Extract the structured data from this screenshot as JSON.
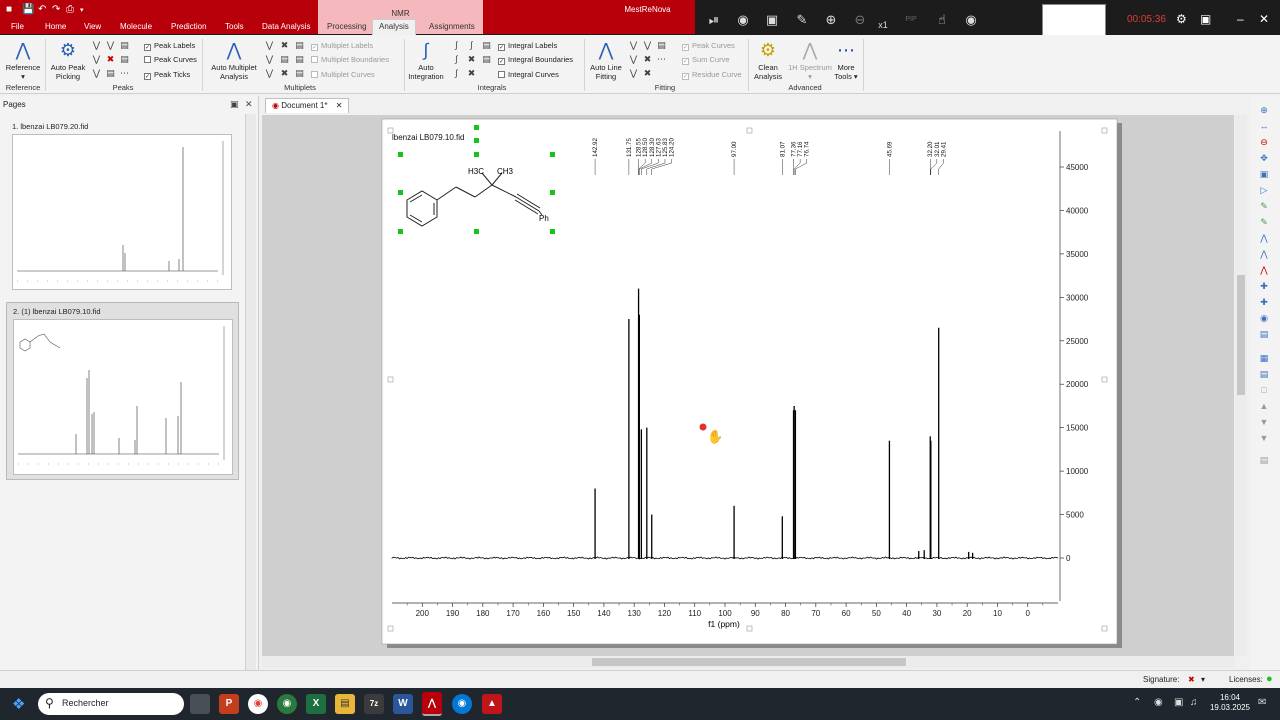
{
  "app": {
    "title": "MestReNova",
    "context_group": "NMR",
    "menu_tabs": [
      "File",
      "Home",
      "View",
      "Molecule",
      "Prediction",
      "Tools",
      "Data Analysis"
    ],
    "context_tabs": [
      "Processing",
      "Analysis",
      "Assignments"
    ],
    "active_tab": "Analysis",
    "timer": "00:05:36",
    "zoom_label": "x1",
    "overlay_tools": [
      "pause-icon",
      "stop-icon",
      "camera-icon",
      "pen-icon",
      "zoom-in-icon",
      "zoom-out-icon",
      "pip-icon",
      "touch-icon",
      "eye-icon"
    ],
    "pip_label": "PIP"
  },
  "ribbon": {
    "reference": {
      "label": "Reference",
      "group": "Reference"
    },
    "peaks": {
      "auto_peak_picking": "Auto Peak Picking",
      "checks": [
        {
          "label": "Peak Labels",
          "checked": true
        },
        {
          "label": "Peak Curves",
          "checked": false
        },
        {
          "label": "Peak Ticks",
          "checked": true
        }
      ],
      "group": "Peaks"
    },
    "multiplets": {
      "auto_multiplet": "Auto Multiplet Analysis",
      "checks": [
        {
          "label": "Multiplet Labels",
          "checked": true
        },
        {
          "label": "Multiplet Boundaries",
          "checked": false
        },
        {
          "label": "Multiplet Curves",
          "checked": false
        }
      ],
      "group": "Multiplets"
    },
    "integrals": {
      "auto_integration": "Auto Integration",
      "checks": [
        {
          "label": "Integral Labels",
          "checked": true
        },
        {
          "label": "Integral Boundaries",
          "checked": true
        },
        {
          "label": "Integral Curves",
          "checked": false
        }
      ],
      "group": "Integrals"
    },
    "fitting": {
      "auto_line_fitting": "Auto Line Fitting",
      "checks": [
        {
          "label": "Peak Curves",
          "checked": true
        },
        {
          "label": "Sum Curve",
          "checked": true
        },
        {
          "label": "Residue Curve",
          "checked": true
        }
      ],
      "group": "Fitting"
    },
    "advanced": {
      "clean_analysis": "Clean Analysis",
      "spectrum_1h": "1H Spectrum",
      "more_tools": "More Tools",
      "group": "Advanced"
    }
  },
  "pages_pane": {
    "title": "Pages",
    "items": [
      {
        "label": "1. lbenzai LB079.20.fid"
      },
      {
        "label": "2. (1) lbenzai LB079.10.fid"
      }
    ]
  },
  "document": {
    "tab_label": "Document 1*",
    "spectrum_title": "lbenzai LB079.10.fid",
    "molecule": {
      "label_h3c": "H3C",
      "label_ch3": "CH3",
      "label_ph": "Ph"
    }
  },
  "chart_data": {
    "type": "line",
    "title": "lbenzai LB079.10.fid",
    "xlabel": "f1 (ppm)",
    "ylabel": "",
    "xlim": [
      210,
      -10
    ],
    "ylim": [
      -2000,
      47000
    ],
    "x_reversed": true,
    "x_ticks": [
      200,
      190,
      180,
      170,
      160,
      150,
      140,
      130,
      120,
      110,
      100,
      90,
      80,
      70,
      60,
      50,
      40,
      30,
      20,
      10,
      0
    ],
    "y_ticks": [
      0,
      5000,
      10000,
      15000,
      20000,
      25000,
      30000,
      35000,
      40000,
      45000
    ],
    "peak_labels": [
      "142.92",
      "131.75",
      "128.55",
      "128.50",
      "128.30",
      "127.63",
      "125.83",
      "124.20",
      "97.00",
      "81.07",
      "77.36",
      "77.16",
      "76.74",
      "45.69",
      "32.20",
      "32.01",
      "29.41"
    ],
    "peaks": [
      {
        "ppm": 142.92,
        "height": 8000
      },
      {
        "ppm": 131.75,
        "height": 27500
      },
      {
        "ppm": 128.55,
        "height": 31000
      },
      {
        "ppm": 128.3,
        "height": 28000
      },
      {
        "ppm": 127.63,
        "height": 14800
      },
      {
        "ppm": 125.83,
        "height": 15000
      },
      {
        "ppm": 124.2,
        "height": 5000
      },
      {
        "ppm": 97.0,
        "height": 6000
      },
      {
        "ppm": 81.07,
        "height": 4800
      },
      {
        "ppm": 77.36,
        "height": 17000
      },
      {
        "ppm": 77.16,
        "height": 17500
      },
      {
        "ppm": 76.74,
        "height": 17000
      },
      {
        "ppm": 45.69,
        "height": 13500
      },
      {
        "ppm": 32.2,
        "height": 14000
      },
      {
        "ppm": 32.01,
        "height": 13500
      },
      {
        "ppm": 29.41,
        "height": 26500
      },
      {
        "ppm": 36.0,
        "height": 800
      },
      {
        "ppm": 34.2,
        "height": 900
      },
      {
        "ppm": 19.5,
        "height": 700
      },
      {
        "ppm": 18.2,
        "height": 600
      }
    ],
    "grid": false,
    "legend": "none"
  },
  "statusbar": {
    "signature": "Signature:",
    "licenses": "Licenses:"
  },
  "taskbar": {
    "search_placeholder": "Rechercher",
    "apps": [
      "task-view",
      "powerpoint",
      "chrome",
      "chemdraw",
      "excel",
      "explorer",
      "notes",
      "word",
      "mestrenova",
      "outlook",
      "acrobat"
    ],
    "time": "16:04",
    "date": "19.03.2025"
  },
  "colors": {
    "title_red": "#b8000b",
    "context_pink": "#f4b8bd",
    "selection_green": "#18c418",
    "spectrum": "#000000"
  }
}
